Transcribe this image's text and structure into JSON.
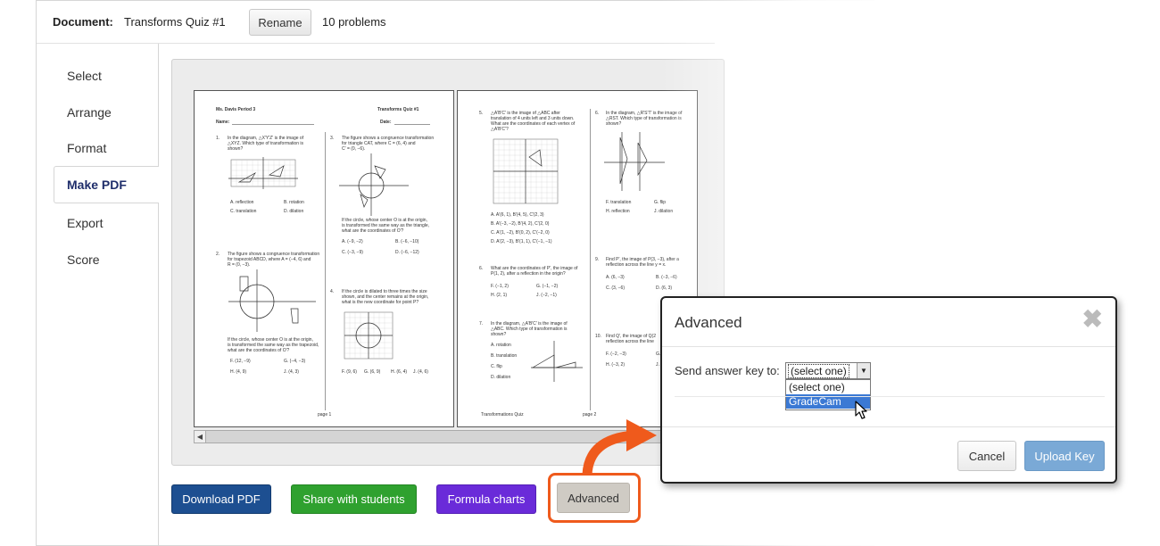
{
  "header": {
    "document_label": "Document:",
    "document_name": "Transforms Quiz #1",
    "rename_label": "Rename",
    "problem_count": "10 problems"
  },
  "sidebar": {
    "items": [
      {
        "label": "Select"
      },
      {
        "label": "Arrange"
      },
      {
        "label": "Format"
      },
      {
        "label": "Make PDF"
      },
      {
        "label": "Export"
      },
      {
        "label": "Score"
      }
    ],
    "active": "Make PDF"
  },
  "preview": {
    "page1": {
      "teacher": "Ms. Davis Period 3",
      "title": "Transforms Quiz #1",
      "name_label": "Name:",
      "date_label": "Date:",
      "q1": "In the diagram, △X'Y'Z' is the image of",
      "q1b": "△XYZ. Which type of transformation is",
      "q1c": "shown?",
      "q1_opts": [
        "A. reflection",
        "B. rotation",
        "C. translation",
        "D. dilation"
      ],
      "q2": "The figure shows a congruence transformation",
      "q2b": "for trapezoid ABCD, where A = (−4, 6) and",
      "q2c": "R = (0, −3).",
      "q2d": "If the circle, whose center O is at the origin,",
      "q2e": "is transformed the same way as the trapezoid,",
      "q2f": "what are the coordinates of O'?",
      "q2_opts": [
        "F. (12, −9)",
        "G. (−4, −3)",
        "H. (4, 9)",
        "J. (4, 3)"
      ],
      "q3": "The figure shows a congruence transformation",
      "q3b": "for triangle CAT, where C = (6, 4) and",
      "q3c": "C' = (0, −6).",
      "q3d": "If the circle, whose center O is at the origin,",
      "q3e": "is transformed the same way as the triangle,",
      "q3f": "what are the coordinates of O'?",
      "q3_opts": [
        "A. (−9, −2)",
        "B. (−6, −10)",
        "C. (−3, −9)",
        "D. (−6, −12)"
      ],
      "q4": "If the circle is dilated to three times the size",
      "q4b": "shown, and the center remains at the origin,",
      "q4c": "what is the new coordinate for point P?",
      "q4_opts": [
        "F. (9, 6)",
        "G. (6, 9)",
        "H. (6, 4)",
        "J. (4, 6)"
      ],
      "footer": "page 1"
    },
    "page2": {
      "q5": "△A'B'C' is the image of △ABC after",
      "q5b": "translation of 4 units left and 3 units down.",
      "q5c": "What are the coordinates of each vertex of",
      "q5d": "△A'B'C'?",
      "q5_opts": [
        "A. A'(6, 1), B'(4, 5), C'(2, 3)",
        "B. A'(−3, −2), B'(4, 2), C'(2, 0)",
        "C. A'(1, −2), B'(0, 2), C'(−2, 0)",
        "D. A'(2, −3), B'(1, 1), C'(−1, −1)"
      ],
      "q6": "In the diagram, △R'S'T' is the image of",
      "q6b": "△RST. Which type of transformation is",
      "q6c": "shown?",
      "q6_opts": [
        "F. translation",
        "G. flip",
        "H. reflection",
        "J. dilation"
      ],
      "q7": "What are the coordinates of P', the image of",
      "q7b": "P(1, 2), after a reflection in the origin?",
      "q7_opts": [
        "F. (−1, 2)",
        "G. (−1, −2)",
        "H. (2, 1)",
        "J. (−2, −1)"
      ],
      "q8": "In the diagram, △A'B'C' is the image of",
      "q8b": "△ABC. Which type of transformation is",
      "q8c": "shown?",
      "q8_opts": [
        "A. rotation",
        "B. translation",
        "C. flip",
        "D. dilation"
      ],
      "q9": "Find P', the image of P(3, −3), after a",
      "q9b": "reflection across the line y = x.",
      "q9_opts": [
        "A. (6, −3)",
        "B. (−3, −6)",
        "C. (3, −6)",
        "D. (6, 3)"
      ],
      "q10": "Find Q', the image of Q(2",
      "q10b": "reflection across the line",
      "q10_opts": [
        "F. (−2, −3)",
        "G.",
        "H. (−3, 2)",
        "J."
      ],
      "footer_left": "Transformations Quiz",
      "footer": "page 2"
    }
  },
  "buttons": {
    "download": "Download PDF",
    "share": "Share with students",
    "formula": "Formula charts",
    "advanced": "Advanced"
  },
  "dialog": {
    "title": "Advanced",
    "close_glyph": "✖",
    "send_label": "Send answer key to:",
    "select_value": "(select one)",
    "options": [
      "(select one)",
      "GradeCam"
    ],
    "highlighted_option": "GradeCam",
    "cancel": "Cancel",
    "upload": "Upload Key"
  },
  "colors": {
    "download_bg": "#1d4f91",
    "share_bg": "#2fa12f",
    "formula_bg": "#6a2bd9",
    "highlight": "#ef5a1c",
    "upload_bg": "#7aa9d6",
    "active_nav": "#1f2e6b"
  },
  "icons": {
    "close": "close-icon",
    "arrow": "curved-arrow-annotation",
    "cursor": "mouse-pointer-icon",
    "dropdown": "dropdown-arrow-icon"
  }
}
